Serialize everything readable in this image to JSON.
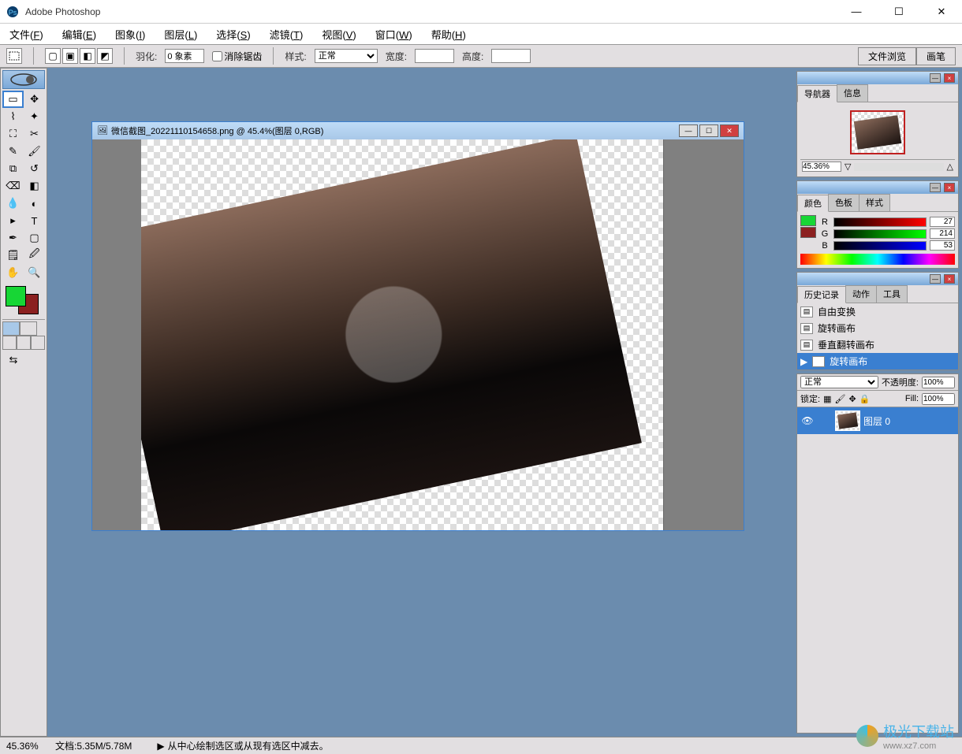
{
  "titlebar": {
    "title": "Adobe Photoshop"
  },
  "menubar": {
    "items": [
      {
        "label": "文件",
        "key": "F"
      },
      {
        "label": "编辑",
        "key": "E"
      },
      {
        "label": "图象",
        "key": "I"
      },
      {
        "label": "图层",
        "key": "L"
      },
      {
        "label": "选择",
        "key": "S"
      },
      {
        "label": "滤镜",
        "key": "T"
      },
      {
        "label": "视图",
        "key": "V"
      },
      {
        "label": "窗口",
        "key": "W"
      },
      {
        "label": "帮助",
        "key": "H"
      }
    ]
  },
  "options": {
    "feather_label": "羽化:",
    "feather_value": "0 象素",
    "antialias_label": "消除锯齿",
    "style_label": "样式:",
    "style_value": "正常",
    "width_label": "宽度:",
    "height_label": "高度:",
    "dock_tabs": [
      "文件浏览",
      "画笔"
    ]
  },
  "document": {
    "title": "微信截图_20221110154658.png @ 45.4%(图层 0,RGB)"
  },
  "navigator": {
    "tabs": [
      "导航器",
      "信息"
    ],
    "zoom": "45.36%"
  },
  "color": {
    "tabs": [
      "颜色",
      "色板",
      "样式"
    ],
    "r_label": "R",
    "r_value": "27",
    "g_label": "G",
    "g_value": "214",
    "b_label": "B",
    "b_value": "53",
    "fg_color": "#17d635",
    "bg_color": "#8b2020"
  },
  "history": {
    "tabs": [
      "历史记录",
      "动作",
      "工具"
    ],
    "items": [
      {
        "label": "自由变换",
        "sel": false
      },
      {
        "label": "旋转画布",
        "sel": false
      },
      {
        "label": "垂直翻转画布",
        "sel": false
      },
      {
        "label": "旋转画布",
        "sel": true
      }
    ]
  },
  "layers": {
    "blend_mode": "正常",
    "opacity_label": "不透明度:",
    "opacity_value": "100%",
    "lock_label": "锁定:",
    "fill_label": "Fill:",
    "fill_value": "100%",
    "layer0": "图层 0"
  },
  "status": {
    "zoom": "45.36%",
    "doc": "文档:5.35M/5.78M",
    "hint": "从中心绘制选区或从现有选区中减去。"
  },
  "watermark": {
    "text": "极光下载站",
    "url": "www.xz7.com"
  }
}
